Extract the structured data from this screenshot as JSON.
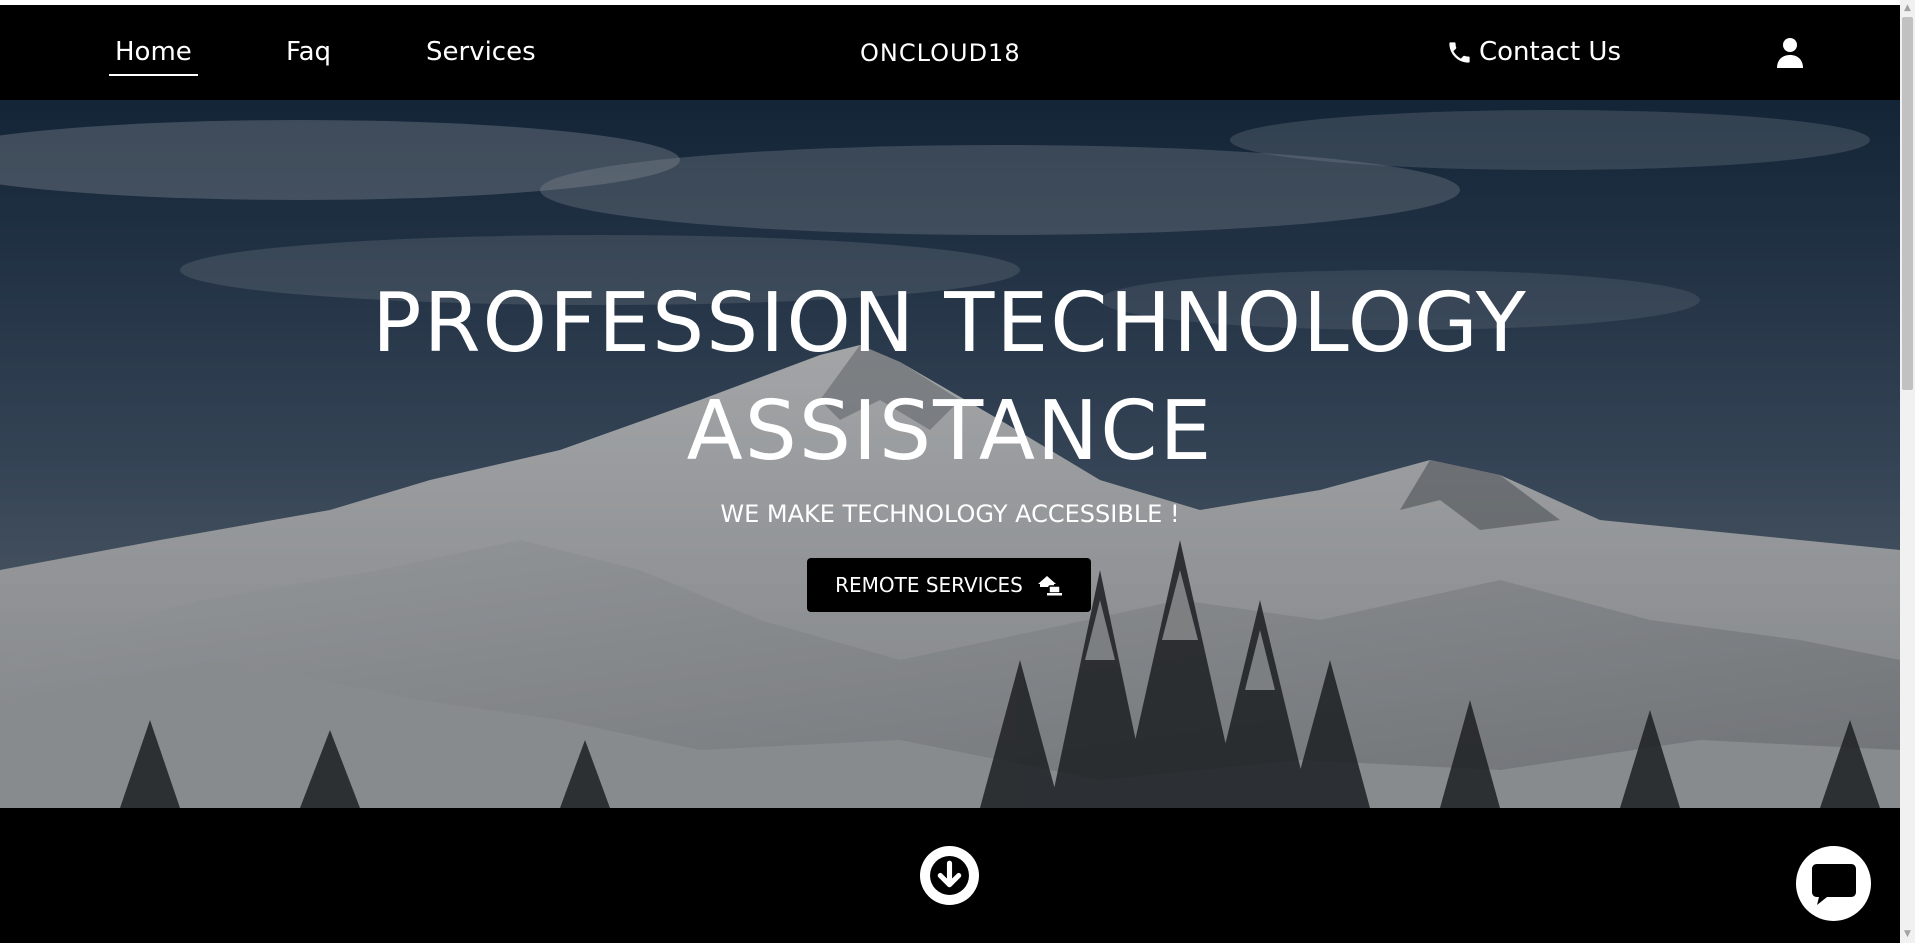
{
  "nav": {
    "links": [
      {
        "label": "Home",
        "active": true
      },
      {
        "label": "Faq",
        "active": false
      },
      {
        "label": "Services",
        "active": false
      }
    ],
    "brand": "ONCLOUD18",
    "contact_label": "Contact Us",
    "contact_icon": "phone-icon",
    "user_icon": "user-icon"
  },
  "hero": {
    "title_line1": "PROFESSION TECHNOLOGY",
    "title_line2": "ASSISTANCE",
    "subtitle": "WE MAKE TECHNOLOGY ACCESSIBLE !",
    "button_label": "REMOTE SERVICES",
    "button_icon": "home-laptop-icon",
    "background": "snowy-mountain-photo"
  },
  "bottom": {
    "scroll_icon": "arrow-down-circle-icon",
    "chat_icon": "chat-bubble-icon"
  },
  "colors": {
    "nav_background": "#000000",
    "text": "#ffffff",
    "button_background": "#000000"
  }
}
